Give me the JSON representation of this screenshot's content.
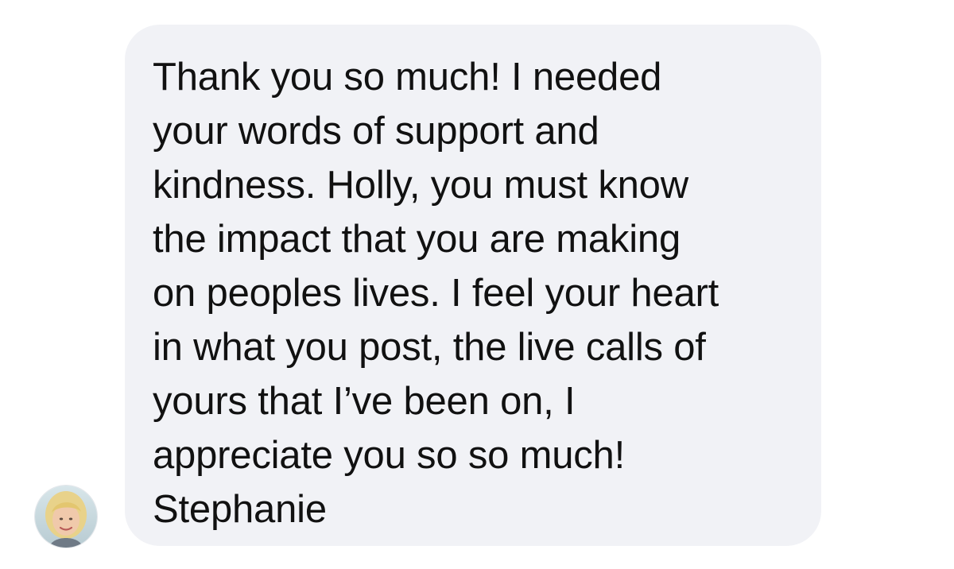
{
  "message": {
    "lines": [
      "Thank you so much! I needed",
      "your words of support and",
      "kindness. Holly, you must know",
      "the impact that you are making",
      "on peoples lives. I feel your heart",
      "in what you post, the live calls of",
      "yours that I’ve been on, I",
      "appreciate you so so much!",
      "Stephanie"
    ]
  },
  "sender": {
    "avatar_icon": "profile-photo-icon"
  },
  "colors": {
    "bubble_background": "#f1f2f6",
    "text": "#111111",
    "page_background": "#ffffff"
  }
}
